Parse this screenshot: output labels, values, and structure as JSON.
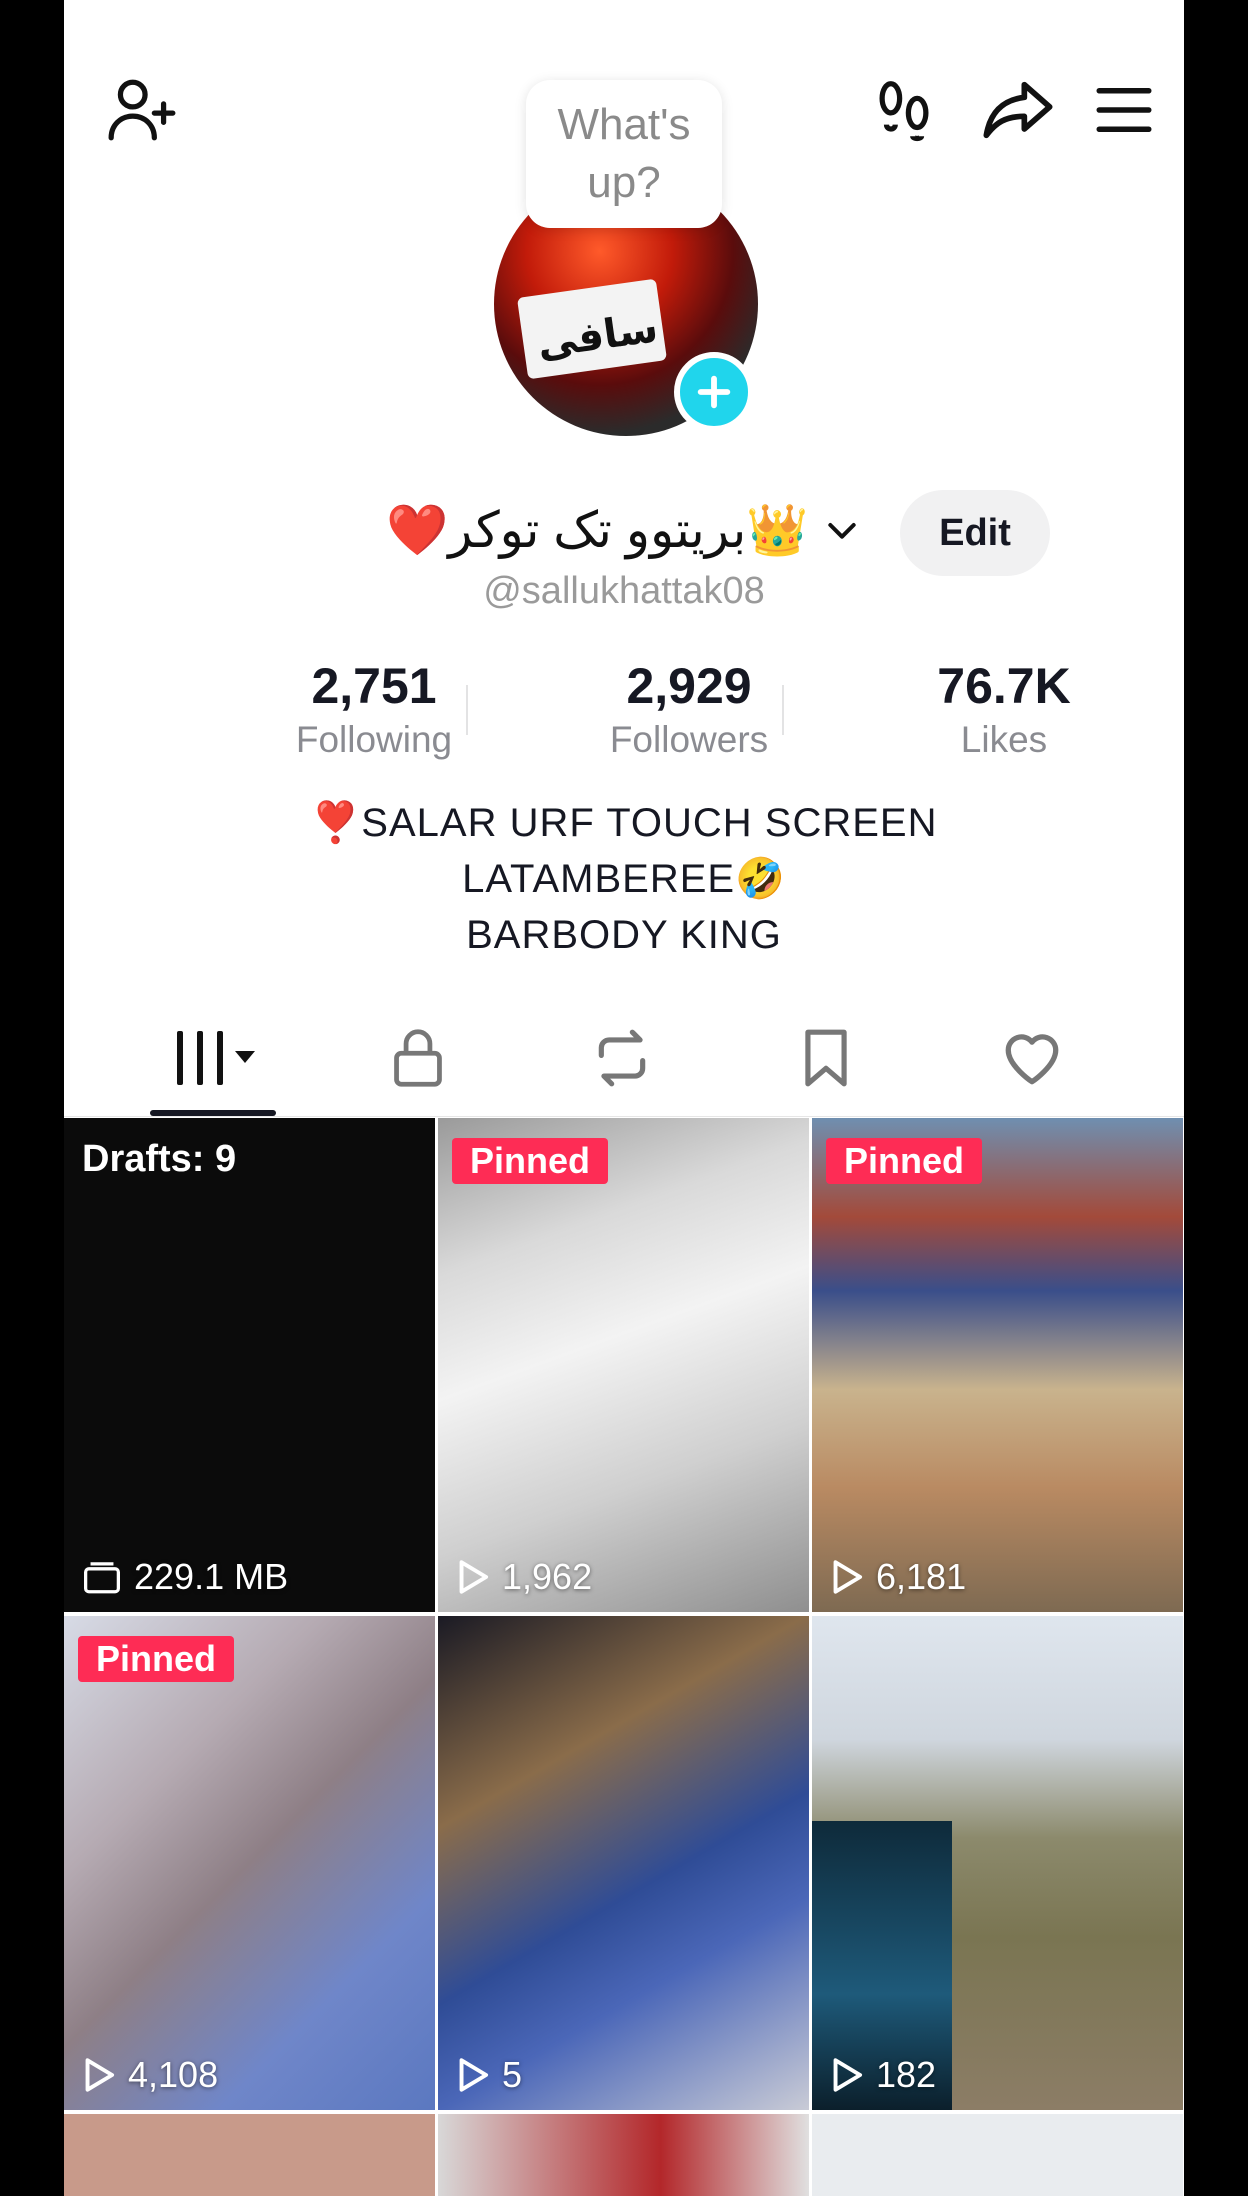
{
  "bubble": {
    "text": "What's\nup?"
  },
  "profile": {
    "display_name": "❤️بریتوو تک توکر👑",
    "handle": "@sallukhattak08",
    "edit_label": "Edit"
  },
  "stats": [
    {
      "value": "2,751",
      "label": "Following"
    },
    {
      "value": "2,929",
      "label": "Followers"
    },
    {
      "value": "76.7K",
      "label": "Likes"
    }
  ],
  "bio": [
    "❣️SALAR URF TOUCH SCREEN",
    "LATAMBEREE🤣",
    "BARBODY KING"
  ],
  "grid": {
    "drafts_label": "Drafts: 9",
    "drafts_size": "229.1 MB",
    "pinned_label": "Pinned",
    "videos": [
      {
        "views": "1,962",
        "pinned": true
      },
      {
        "views": "6,181",
        "pinned": true
      },
      {
        "views": "4,108",
        "pinned": true
      },
      {
        "views": "5",
        "pinned": false
      },
      {
        "views": "182",
        "pinned": false
      }
    ]
  },
  "colors": {
    "accent": "#fe2c55",
    "plus": "#20d5ec",
    "text": "#161823",
    "muted": "#8a8b91"
  }
}
